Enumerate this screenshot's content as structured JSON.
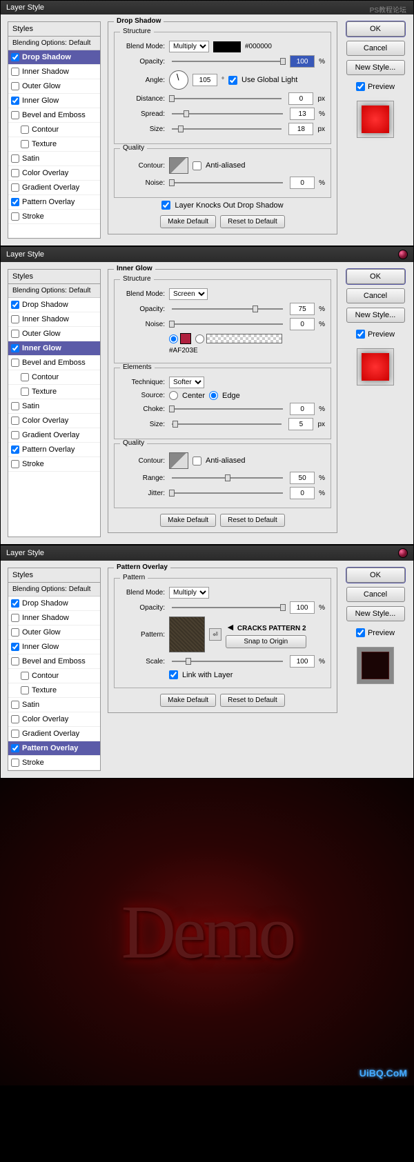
{
  "d1": {
    "title": "Layer Style",
    "effect": "Drop Shadow",
    "styles_header": "Styles",
    "blend_opts": "Blending Options: Default",
    "items": [
      {
        "label": "Drop Shadow",
        "checked": true,
        "active": true
      },
      {
        "label": "Inner Shadow",
        "checked": false
      },
      {
        "label": "Outer Glow",
        "checked": false
      },
      {
        "label": "Inner Glow",
        "checked": true
      },
      {
        "label": "Bevel and Emboss",
        "checked": false
      },
      {
        "label": "Contour",
        "checked": false,
        "indent": true
      },
      {
        "label": "Texture",
        "checked": false,
        "indent": true
      },
      {
        "label": "Satin",
        "checked": false
      },
      {
        "label": "Color Overlay",
        "checked": false
      },
      {
        "label": "Gradient Overlay",
        "checked": false
      },
      {
        "label": "Pattern Overlay",
        "checked": true
      },
      {
        "label": "Stroke",
        "checked": false
      }
    ],
    "structure": "Structure",
    "quality": "Quality",
    "blend_mode_label": "Blend Mode:",
    "blend_mode": "Multiply",
    "color": "#000000",
    "opacity_label": "Opacity:",
    "opacity": "100",
    "pct": "%",
    "angle_label": "Angle:",
    "angle": "105",
    "global": "Use Global Light",
    "distance_label": "Distance:",
    "distance": "0",
    "px": "px",
    "spread_label": "Spread:",
    "spread": "13",
    "size_label": "Size:",
    "size": "18",
    "contour_label": "Contour:",
    "anti": "Anti-aliased",
    "noise_label": "Noise:",
    "noise": "0",
    "knockout": "Layer Knocks Out Drop Shadow",
    "make_default": "Make Default",
    "reset_default": "Reset to Default",
    "ok": "OK",
    "cancel": "Cancel",
    "new_style": "New Style...",
    "preview": "Preview"
  },
  "d2": {
    "title": "Layer Style",
    "effect": "Inner Glow",
    "styles_header": "Styles",
    "blend_opts": "Blending Options: Default",
    "items": [
      {
        "label": "Drop Shadow",
        "checked": true
      },
      {
        "label": "Inner Shadow",
        "checked": false
      },
      {
        "label": "Outer Glow",
        "checked": false
      },
      {
        "label": "Inner Glow",
        "checked": true,
        "active": true
      },
      {
        "label": "Bevel and Emboss",
        "checked": false
      },
      {
        "label": "Contour",
        "checked": false,
        "indent": true
      },
      {
        "label": "Texture",
        "checked": false,
        "indent": true
      },
      {
        "label": "Satin",
        "checked": false
      },
      {
        "label": "Color Overlay",
        "checked": false
      },
      {
        "label": "Gradient Overlay",
        "checked": false
      },
      {
        "label": "Pattern Overlay",
        "checked": true
      },
      {
        "label": "Stroke",
        "checked": false
      }
    ],
    "structure": "Structure",
    "elements": "Elements",
    "quality": "Quality",
    "blend_mode_label": "Blend Mode:",
    "blend_mode": "Screen",
    "opacity_label": "Opacity:",
    "opacity": "75",
    "pct": "%",
    "noise_label": "Noise:",
    "noise": "0",
    "color_hex": "#AF203E",
    "technique_label": "Technique:",
    "technique": "Softer",
    "source_label": "Source:",
    "center": "Center",
    "edge": "Edge",
    "choke_label": "Choke:",
    "choke": "0",
    "size_label": "Size:",
    "size": "5",
    "px": "px",
    "contour_label": "Contour:",
    "anti": "Anti-aliased",
    "range_label": "Range:",
    "range": "50",
    "jitter_label": "Jitter:",
    "jitter": "0",
    "make_default": "Make Default",
    "reset_default": "Reset to Default",
    "ok": "OK",
    "cancel": "Cancel",
    "new_style": "New Style...",
    "preview": "Preview"
  },
  "d3": {
    "title": "Layer Style",
    "effect": "Pattern Overlay",
    "pattern_sec": "Pattern",
    "styles_header": "Styles",
    "blend_opts": "Blending Options: Default",
    "items": [
      {
        "label": "Drop Shadow",
        "checked": true
      },
      {
        "label": "Inner Shadow",
        "checked": false
      },
      {
        "label": "Outer Glow",
        "checked": false
      },
      {
        "label": "Inner Glow",
        "checked": true
      },
      {
        "label": "Bevel and Emboss",
        "checked": false
      },
      {
        "label": "Contour",
        "checked": false,
        "indent": true
      },
      {
        "label": "Texture",
        "checked": false,
        "indent": true
      },
      {
        "label": "Satin",
        "checked": false
      },
      {
        "label": "Color Overlay",
        "checked": false
      },
      {
        "label": "Gradient Overlay",
        "checked": false
      },
      {
        "label": "Pattern Overlay",
        "checked": true,
        "active": true
      },
      {
        "label": "Stroke",
        "checked": false
      }
    ],
    "blend_mode_label": "Blend Mode:",
    "blend_mode": "Multiply",
    "opacity_label": "Opacity:",
    "opacity": "100",
    "pct": "%",
    "pattern_label": "Pattern:",
    "pattern_name": "CRACKS PATTERN 2",
    "snap": "Snap to Origin",
    "scale_label": "Scale:",
    "scale": "100",
    "link": "Link with Layer",
    "make_default": "Make Default",
    "reset_default": "Reset to Default",
    "ok": "OK",
    "cancel": "Cancel",
    "new_style": "New Style...",
    "preview": "Preview"
  },
  "footer": {
    "demo": "Demo",
    "wm": "UiBQ.CoM",
    "wm2": "PS教程论坛"
  }
}
